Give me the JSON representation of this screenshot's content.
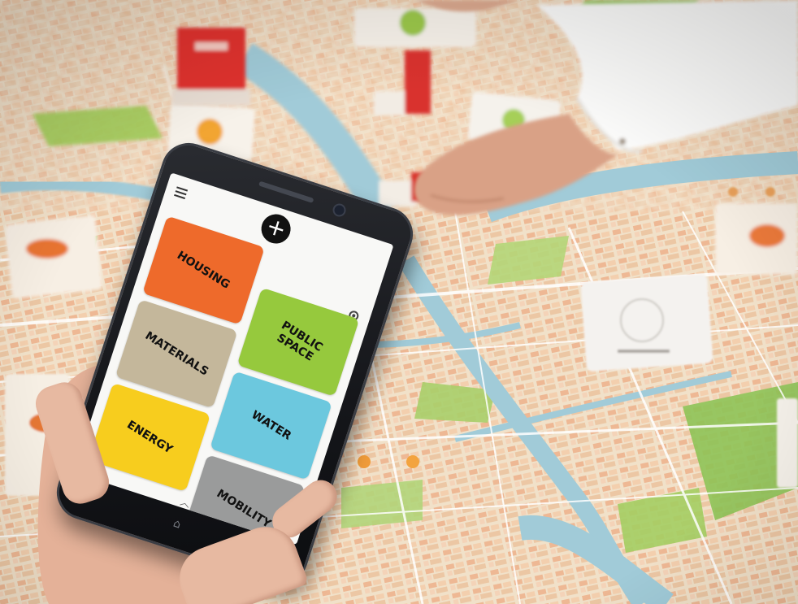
{
  "app": {
    "add_symbol": "+",
    "tiles": [
      {
        "label": "HOUSING",
        "color": "#ee6a2b"
      },
      {
        "label": "PUBLIC\nSPACE",
        "color": "#96c93d"
      },
      {
        "label": "MATERIALS",
        "color": "#c4b79b"
      },
      {
        "label": "WATER",
        "color": "#6cc8de"
      },
      {
        "label": "ENERGY",
        "color": "#f7cd1e"
      },
      {
        "label": "MOBILITY",
        "color": "#9a9b9b"
      }
    ]
  },
  "icons": {
    "menu": "hamburger-menu-icon",
    "add": "plus-icon",
    "settings": "gear-icon",
    "swipe": "chevron-up-icon",
    "back": "back-arrow-icon",
    "home": "home-icon",
    "recents": "recents-icon"
  },
  "colors": {
    "map_base": "#f2e4cf",
    "map_roads": "#ffffff",
    "map_water": "#9fc9d6",
    "map_parks": "#9fcd5b",
    "map_blocks": "#efbf9a",
    "table_marker_red": "#e0322e"
  }
}
